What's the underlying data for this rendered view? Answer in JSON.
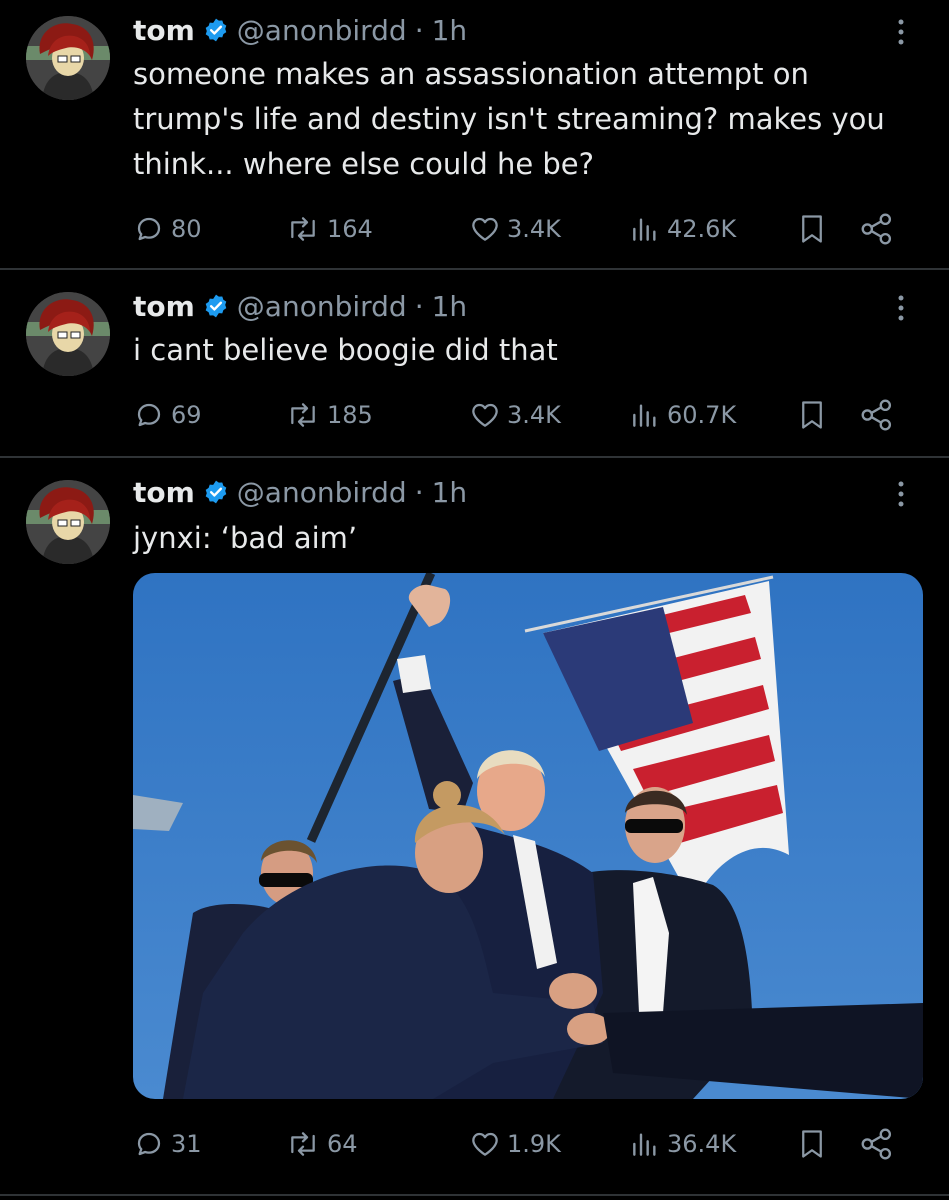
{
  "tweets": [
    {
      "name": "tom",
      "handle": "@anonbirdd",
      "sep": "·",
      "time": "1h",
      "text": "someone makes an assassionation attempt on\ntrump's life and destiny isn't streaming? makes you\nthink... where else could he be?",
      "replies": "80",
      "retweets": "164",
      "likes": "3.4K",
      "views": "42.6K"
    },
    {
      "name": "tom",
      "handle": "@anonbirdd",
      "sep": "·",
      "time": "1h",
      "text": "i cant believe boogie did that",
      "replies": "69",
      "retweets": "185",
      "likes": "3.4K",
      "views": "60.7K"
    },
    {
      "name": "tom",
      "handle": "@anonbirdd",
      "sep": "·",
      "time": "1h",
      "text": "jynxi: ‘bad aim’",
      "replies": "31",
      "retweets": "64",
      "likes": "1.9K",
      "views": "36.4K"
    }
  ],
  "icons": {
    "verified": "verified-badge-icon",
    "more": "more-icon",
    "reply": "reply-icon",
    "retweet": "retweet-icon",
    "like": "like-icon",
    "views": "views-icon",
    "bookmark": "bookmark-icon",
    "share": "share-icon"
  },
  "colors": {
    "background": "#000000",
    "text": "#e7e9ea",
    "secondary": "#8b98a5",
    "verified": "#1d9bf0",
    "divider": "#2f3336"
  }
}
